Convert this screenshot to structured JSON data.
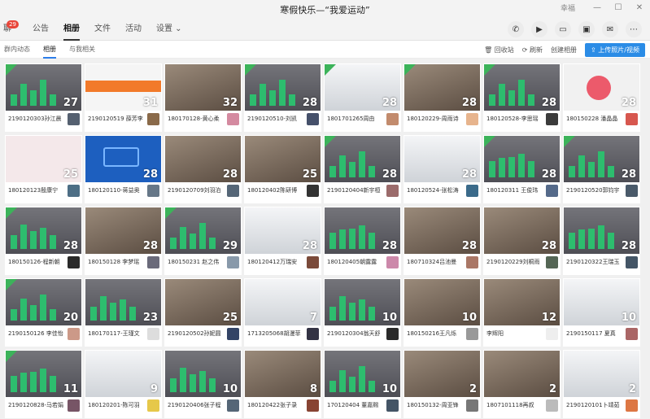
{
  "window": {
    "title": "寒假快乐—“我爱运动”",
    "user": "幸福"
  },
  "tabs": [
    {
      "label": "聊",
      "badge": "29"
    },
    {
      "label": "公告"
    },
    {
      "label": "相册"
    },
    {
      "label": "文件"
    },
    {
      "label": "活动"
    },
    {
      "label": "设置 ⌄"
    }
  ],
  "subtabs": [
    "群内动态",
    "相册",
    "与我相关"
  ],
  "actions": {
    "recycle": "回收站",
    "refresh": "刷新",
    "create_album": "创建相册",
    "upload": "上传照片/视频"
  },
  "albums": [
    {
      "caption": "2190120303孙江晨",
      "count": "27",
      "flag": true,
      "theme": "dark",
      "avatar": "#556070"
    },
    {
      "caption": "2190120519 薛芳李",
      "count": "31",
      "flag": false,
      "theme": "orange",
      "avatar": "#8a6a4a"
    },
    {
      "caption": "180170128-黄心柔",
      "count": "32",
      "flag": false,
      "theme": "room",
      "avatar": "#d48aa0"
    },
    {
      "caption": "2190120510-刘凯",
      "count": "28",
      "flag": true,
      "theme": "dark",
      "avatar": "#45506a"
    },
    {
      "caption": "1801701265周由",
      "count": "28",
      "flag": true,
      "theme": "app",
      "avatar": "#c28b6d"
    },
    {
      "caption": "180120229-周雨诗",
      "count": "28",
      "flag": true,
      "theme": "room",
      "avatar": "#e7b48d"
    },
    {
      "caption": "180120528-李思瑶",
      "count": "28",
      "flag": true,
      "theme": "dark",
      "avatar": "#3b3b3b"
    },
    {
      "caption": "180150228 潘晶晶",
      "count": "28",
      "flag": false,
      "theme": "pink",
      "avatar": "#d7574f"
    },
    {
      "caption": "180120123殷康宁",
      "count": "25",
      "flag": false,
      "theme": "map",
      "avatar": "#4d6e85"
    },
    {
      "caption": "180120110-蒋益奥",
      "count": "28",
      "flag": false,
      "theme": "blue",
      "avatar": "#667788"
    },
    {
      "caption": "2190120709刘羽泊",
      "count": "28",
      "flag": false,
      "theme": "room",
      "avatar": "#556677"
    },
    {
      "caption": "180120402陈研博",
      "count": "25",
      "flag": false,
      "theme": "room",
      "avatar": "#333333"
    },
    {
      "caption": "2190120404新宇桓",
      "count": "28",
      "flag": true,
      "theme": "dark",
      "avatar": "#9b6b6b"
    },
    {
      "caption": "180120524-张松涛",
      "count": "28",
      "flag": false,
      "theme": "app",
      "avatar": "#3a6a8a"
    },
    {
      "caption": "180120311 王俊玮",
      "count": "28",
      "flag": true,
      "theme": "dark",
      "avatar": "#556a8a"
    },
    {
      "caption": "2190120520郭钧宇",
      "count": "28",
      "flag": true,
      "theme": "dark",
      "avatar": "#4a5a6a"
    },
    {
      "caption": "180150126-程新朝",
      "count": "28",
      "flag": true,
      "theme": "dark",
      "avatar": "#2a2a2a"
    },
    {
      "caption": "180150128 李梦瑶",
      "count": "28",
      "flag": false,
      "theme": "room",
      "avatar": "#6a6a7a"
    },
    {
      "caption": "180150231 赵之伟",
      "count": "29",
      "flag": true,
      "theme": "dark",
      "avatar": "#8899aa"
    },
    {
      "caption": "180120412万瑞安",
      "count": "28",
      "flag": false,
      "theme": "app",
      "avatar": "#7a4a3a"
    },
    {
      "caption": "180120405朝露露",
      "count": "28",
      "flag": false,
      "theme": "dark",
      "avatar": "#cc88aa"
    },
    {
      "caption": "180710324吕池曼",
      "count": "28",
      "flag": false,
      "theme": "room",
      "avatar": "#aa7766"
    },
    {
      "caption": "2190120229刘桐雨",
      "count": "28",
      "flag": false,
      "theme": "room",
      "avatar": "#556655"
    },
    {
      "caption": "2190120322王瑞玉",
      "count": "28",
      "flag": false,
      "theme": "dark",
      "avatar": "#445566"
    },
    {
      "caption": "2190150126 李佳怡",
      "count": "20",
      "flag": true,
      "theme": "dark",
      "avatar": "#cc9988"
    },
    {
      "caption": "180170117-王瑾文",
      "count": "23",
      "flag": false,
      "theme": "dark",
      "avatar": "#dddddd"
    },
    {
      "caption": "2190120502孙妮圆",
      "count": "25",
      "flag": false,
      "theme": "room",
      "avatar": "#334466"
    },
    {
      "caption": "1713205068胡漫菲",
      "count": "7",
      "flag": false,
      "theme": "app",
      "avatar": "#333344"
    },
    {
      "caption": "2190120304翁天舒",
      "count": "10",
      "flag": false,
      "theme": "dark",
      "avatar": "#2a2a2a"
    },
    {
      "caption": "180150216王凡烁",
      "count": "10",
      "flag": false,
      "theme": "room",
      "avatar": "#999999"
    },
    {
      "caption": "李辉阳",
      "count": "12",
      "flag": false,
      "theme": "room",
      "avatar": "#eeeeee"
    },
    {
      "caption": "2190150117 夏真",
      "count": "10",
      "flag": false,
      "theme": "app",
      "avatar": "#aa6666"
    },
    {
      "caption": "2190120828-马若娟",
      "count": "11",
      "flag": true,
      "theme": "dark",
      "avatar": "#775566"
    },
    {
      "caption": "180120201-陈可羽",
      "count": "9",
      "flag": false,
      "theme": "app",
      "avatar": "#e6c84a"
    },
    {
      "caption": "2190120406张子程",
      "count": "10",
      "flag": false,
      "theme": "dark",
      "avatar": "#556677"
    },
    {
      "caption": "180120422张子录",
      "count": "8",
      "flag": false,
      "theme": "room",
      "avatar": "#884433"
    },
    {
      "caption": "170120404 董嘉赐",
      "count": "10",
      "flag": false,
      "theme": "dark",
      "avatar": "#445566"
    },
    {
      "caption": "180150132-周亚锋",
      "count": "2",
      "flag": false,
      "theme": "room",
      "avatar": "#777777"
    },
    {
      "caption": "1807101118再叔",
      "count": "2",
      "flag": false,
      "theme": "room",
      "avatar": "#bbbbbb"
    },
    {
      "caption": "2190120101卜靖茹",
      "count": "2",
      "flag": false,
      "theme": "app",
      "avatar": "#dd7744"
    }
  ],
  "colors": {
    "flag": "#3cb35a",
    "dark": "#6a6a70",
    "orange": "#f27a2a",
    "room": "#7d6b5c",
    "blue": "#1d5fbf",
    "app": "#dfe2e6",
    "pink": "#f1f1f1",
    "map": "#f4e8ea",
    "upload": "#2b8ce6"
  }
}
